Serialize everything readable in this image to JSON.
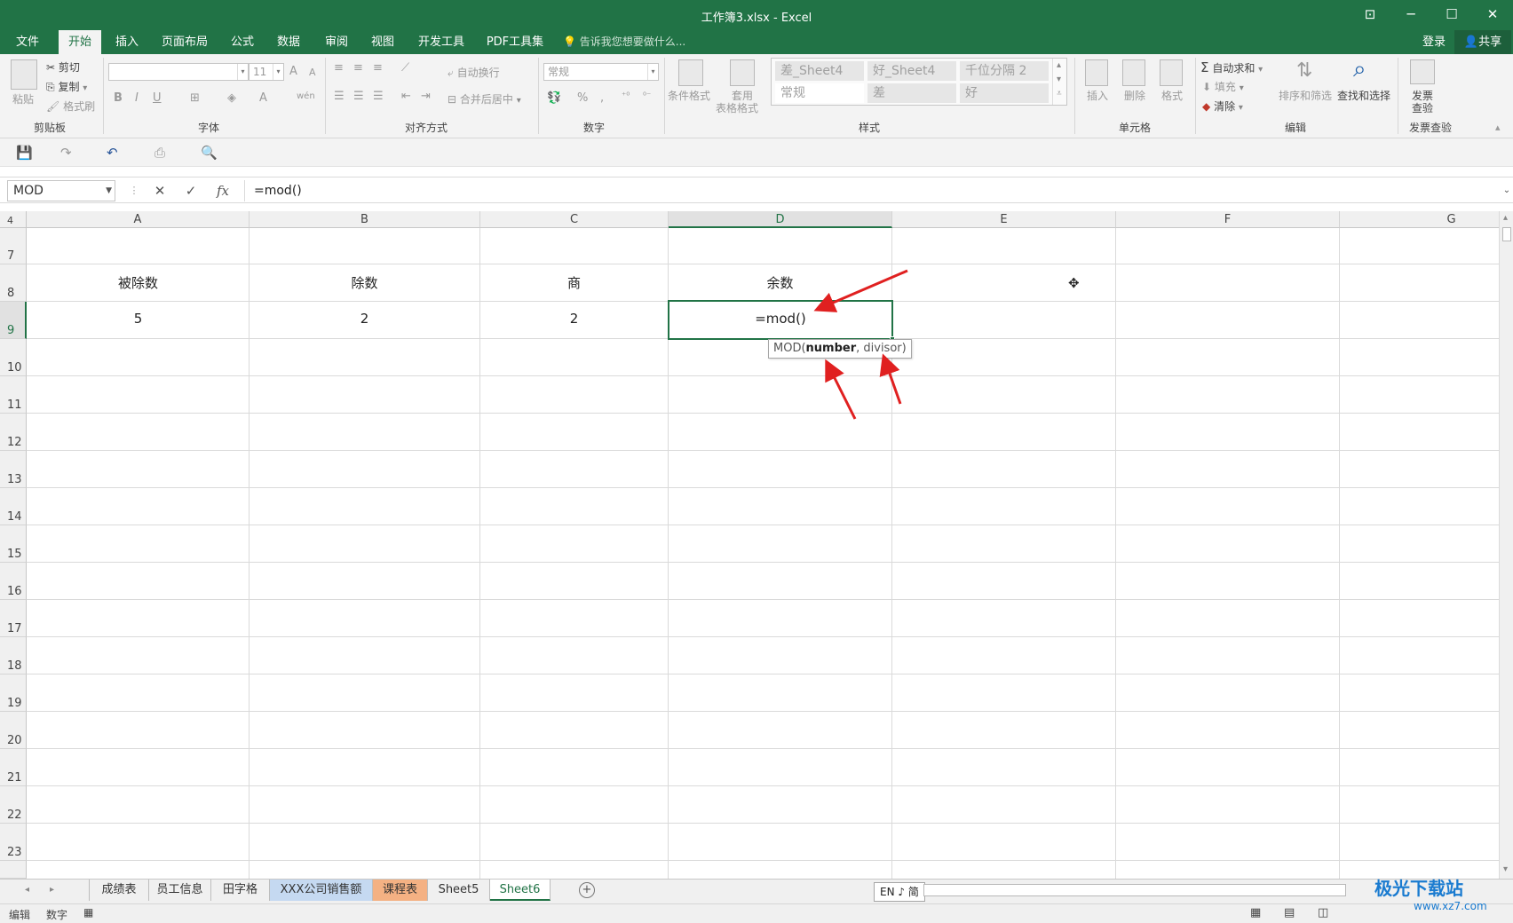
{
  "window": {
    "title": "工作簿3.xlsx - Excel",
    "restore_icon": "ribbon-display-icon",
    "minimize": "─",
    "maximize": "☐",
    "close": "✕"
  },
  "menu": {
    "tabs": [
      "文件",
      "开始",
      "插入",
      "页面布局",
      "公式",
      "数据",
      "审阅",
      "视图",
      "开发工具",
      "PDF工具集"
    ],
    "active_tab": "开始",
    "tell_me": "告诉我您想要做什么...",
    "login": "登录",
    "share": "共享"
  },
  "ribbon": {
    "clipboard": {
      "label": "剪贴板",
      "paste": "粘贴",
      "cut": "剪切",
      "copy": "复制",
      "format_painter": "格式刷"
    },
    "font": {
      "label": "字体",
      "font_name": "",
      "font_size": "11",
      "bold": "B",
      "italic": "I",
      "underline": "U",
      "increase": "A",
      "decrease": "A",
      "font_color": "A",
      "phonetic": "wén"
    },
    "alignment": {
      "label": "对齐方式",
      "wrap": "自动换行",
      "merge": "合并后居中"
    },
    "number": {
      "label": "数字",
      "format": "常规",
      "percent": "%",
      "comma": ","
    },
    "styles": {
      "label": "样式",
      "conditional": "条件格式",
      "table_format_1": "套用",
      "table_format_2": "表格格式",
      "cells": [
        "差_Sheet4",
        "好_Sheet4",
        "千位分隔 2",
        "常规",
        "差",
        "好"
      ]
    },
    "cells_group": {
      "label": "单元格",
      "insert": "插入",
      "delete": "删除",
      "format": "格式"
    },
    "editing": {
      "label": "编辑",
      "autosum": "自动求和",
      "fill": "填充",
      "clear": "清除",
      "sort": "排序和筛选",
      "find": "查找和选择"
    },
    "invoice": {
      "label": "发票查验",
      "btn_1": "发票",
      "btn_2": "查验"
    }
  },
  "formula_bar": {
    "name_box": "MOD",
    "cancel": "✕",
    "enter": "✓",
    "fx": "fx",
    "content": "=mod()"
  },
  "grid": {
    "columns": [
      "A",
      "B",
      "C",
      "D",
      "E",
      "F",
      "G"
    ],
    "selected_column": "D",
    "rows": [
      "7",
      "8",
      "9",
      "10",
      "11",
      "12",
      "13",
      "14",
      "15",
      "16",
      "17",
      "18",
      "19",
      "20",
      "21",
      "22",
      "23"
    ],
    "partial_row": "4",
    "selected_row": "9",
    "cells": {
      "A8": "被除数",
      "B8": "除数",
      "C8": "商",
      "D8": "余数",
      "A9": "5",
      "B9": "2",
      "C9": "2",
      "D9": "=mod()"
    },
    "tooltip": {
      "prefix": "MOD(",
      "bold": "number",
      "suffix": ", divisor)"
    }
  },
  "sheet_tabs": {
    "tabs": [
      "成绩表",
      "员工信息",
      "田字格",
      "XXX公司销售额",
      "课程表",
      "Sheet5",
      "Sheet6"
    ],
    "active": "Sheet6",
    "tab_colors": {
      "XXX公司销售额": "#c5d9f1",
      "课程表": "#f4b183"
    },
    "ime": "EN ♪ 简"
  },
  "status_bar": {
    "mode": "编辑",
    "num": "数字"
  },
  "watermark": {
    "main": "极光下载站",
    "sub": "www.xz7.com"
  },
  "colors": {
    "brand": "#217346",
    "annotation_arrow": "#e02020"
  }
}
